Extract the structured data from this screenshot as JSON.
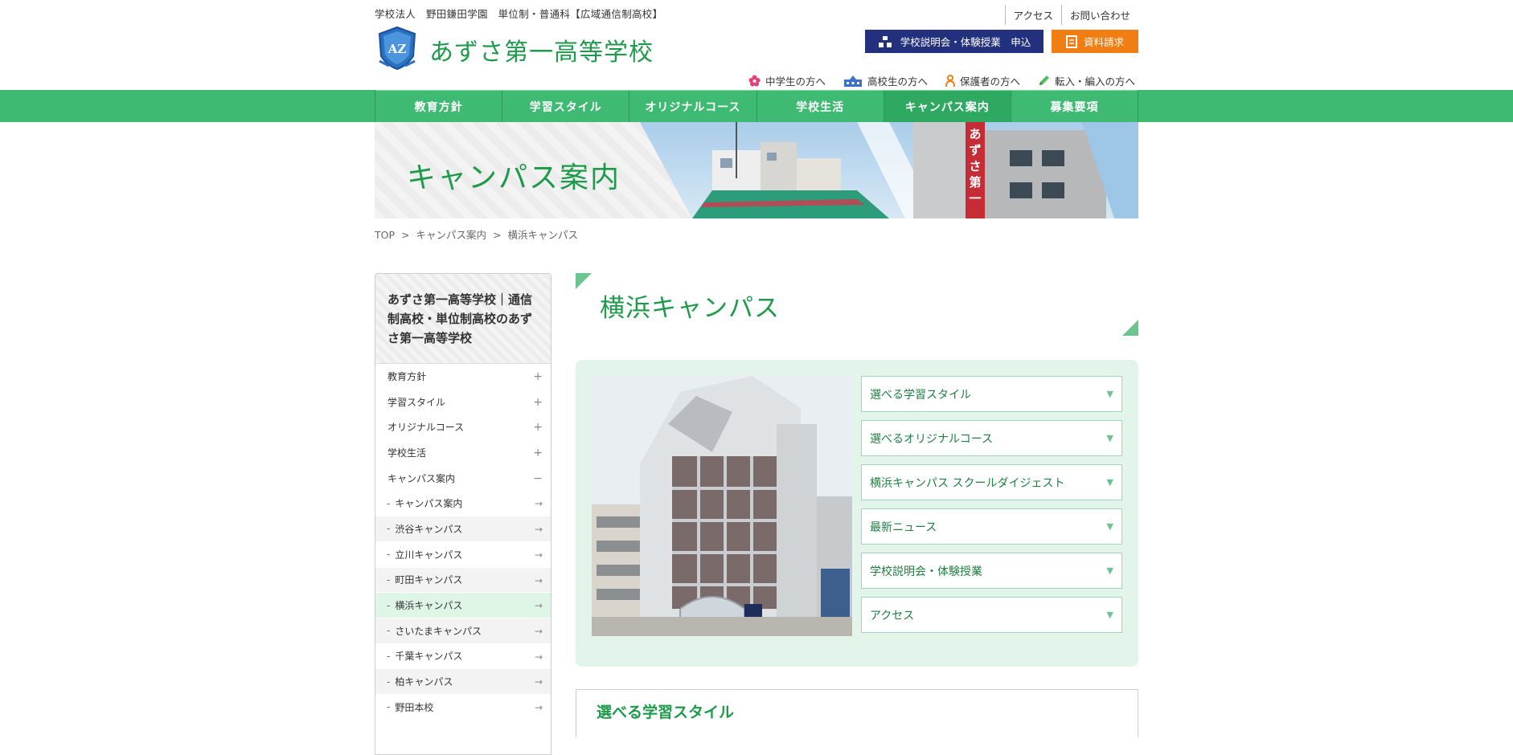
{
  "header": {
    "subtitle": "学校法人　野田鎌田学園　単位制・普通科【広域通信制高校】",
    "school_name": "あずさ第一高等学校",
    "top_links": [
      "アクセス",
      "お問い合わせ"
    ],
    "seminar_button": "学校説明会・体験授業　申込",
    "request_button": "資料請求",
    "audience_links": [
      {
        "label": "中学生の方へ",
        "icon": "flower-icon"
      },
      {
        "label": "高校生の方へ",
        "icon": "school-building-icon"
      },
      {
        "label": "保護者の方へ",
        "icon": "parent-icon"
      },
      {
        "label": "転入・編入の方へ",
        "icon": "pencil-icon"
      }
    ]
  },
  "nav": {
    "items": [
      "教育方針",
      "学習スタイル",
      "オリジナルコース",
      "学校生活",
      "キャンパス案内",
      "募集要項"
    ],
    "active": "キャンパス案内"
  },
  "hero": {
    "title": "キャンパス案内"
  },
  "breadcrumb": [
    "TOP",
    ">",
    "キャンパス案内",
    ">",
    "横浜キャンパス"
  ],
  "sidebar": {
    "heading": "あずさ第一高等学校｜通信制高校・単位制高校のあずさ第一高等学校",
    "items": [
      {
        "label": "教育方針",
        "mark": "+"
      },
      {
        "label": "学習スタイル",
        "mark": "+"
      },
      {
        "label": "オリジナルコース",
        "mark": "+"
      },
      {
        "label": "学校生活",
        "mark": "+"
      },
      {
        "label": "キャンパス案内",
        "mark": "−"
      }
    ],
    "sub_items": [
      {
        "label": "キャンパス案内",
        "active": false
      },
      {
        "label": "渋谷キャンパス",
        "active": false
      },
      {
        "label": "立川キャンパス",
        "active": false
      },
      {
        "label": "町田キャンパス",
        "active": false
      },
      {
        "label": "横浜キャンパス",
        "active": true
      },
      {
        "label": "さいたまキャンパス",
        "active": false
      },
      {
        "label": "千葉キャンパス",
        "active": false
      },
      {
        "label": "柏キャンパス",
        "active": false
      },
      {
        "label": "野田本校",
        "active": false
      }
    ]
  },
  "main": {
    "page_title": "横浜キャンパス",
    "accordion": [
      "選べる学習スタイル",
      "選べるオリジナルコース",
      "横浜キャンパス スクールダイジェスト",
      "最新ニュース",
      "学校説明会・体験授業",
      "アクセス"
    ],
    "section_title": "選べる学習スタイル"
  },
  "colors": {
    "brand_green": "#1e9b4a",
    "nav_green": "#3fba72",
    "seminar_navy": "#23307e",
    "request_orange": "#f07e13",
    "panel_mint": "#e3f5ea"
  }
}
